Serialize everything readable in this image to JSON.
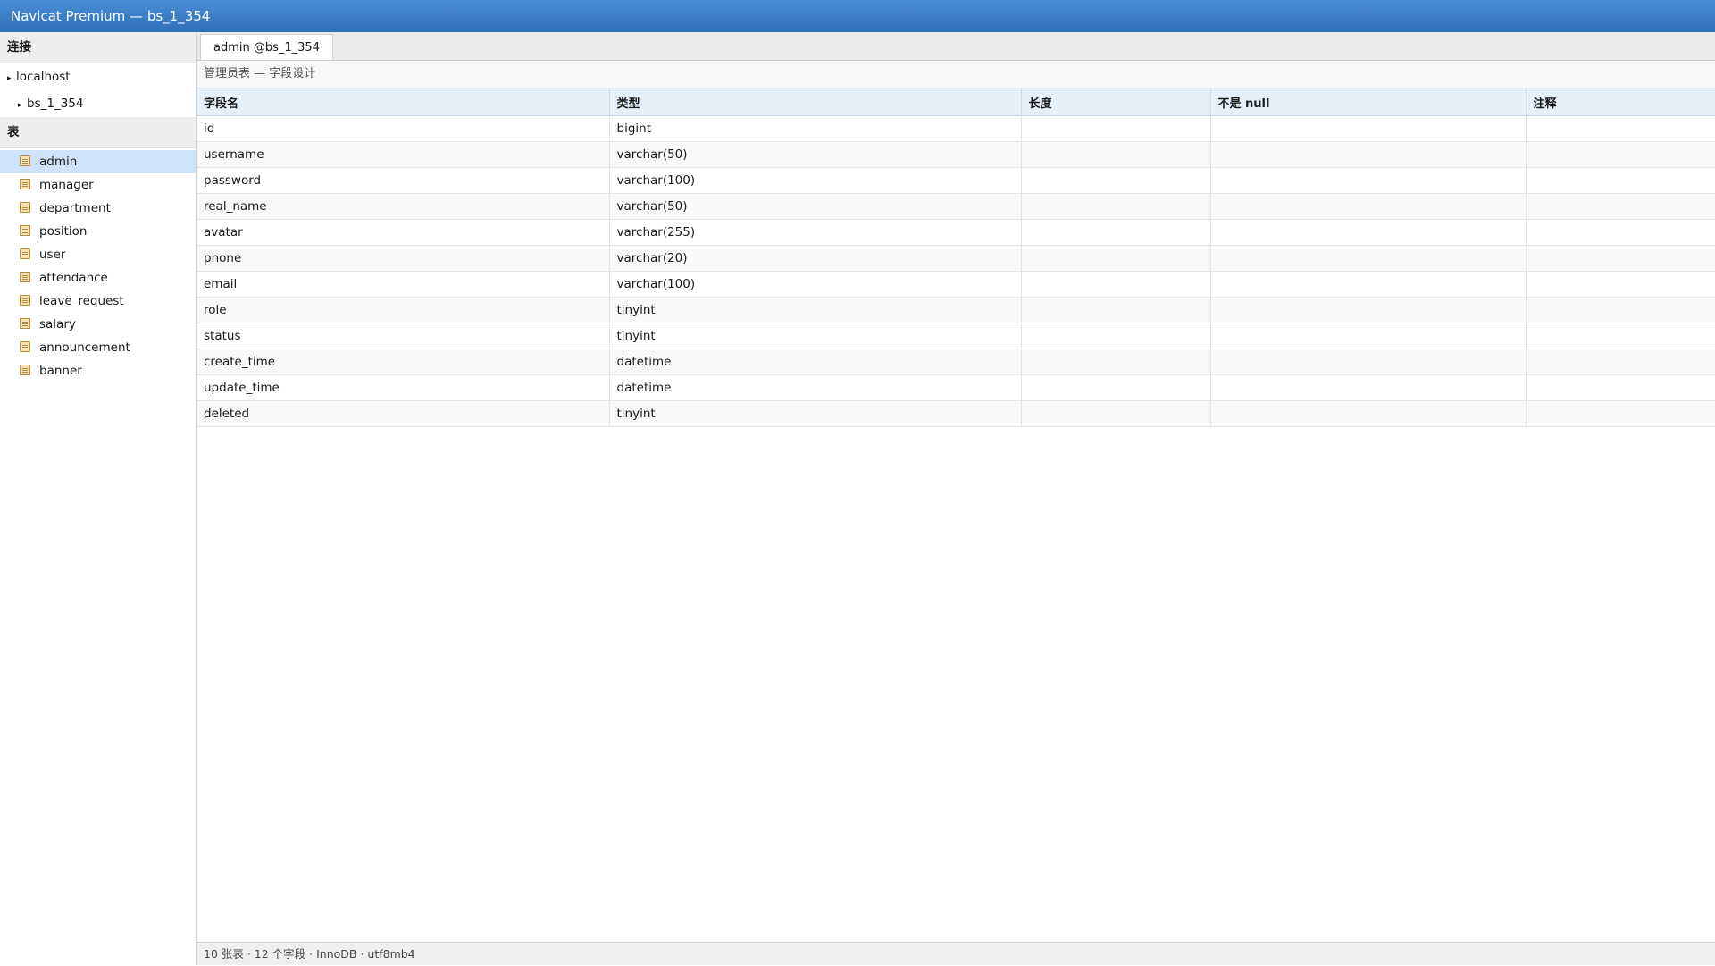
{
  "window": {
    "title": "Navicat Premium — bs_1_354"
  },
  "sidebar": {
    "connections_header": "连接",
    "connection": "localhost",
    "database": "bs_1_354",
    "tables_header": "表",
    "tables": [
      "admin",
      "manager",
      "department",
      "position",
      "user",
      "attendance",
      "leave_request",
      "salary",
      "announcement",
      "banner"
    ],
    "active_table": "admin"
  },
  "tab": {
    "label": "admin @bs_1_354"
  },
  "designer": {
    "subtitle": "管理员表 — 字段设计",
    "columns": [
      "字段名",
      "类型",
      "长度",
      "不是 null",
      "注释"
    ],
    "rows": [
      [
        "id",
        "bigint",
        "",
        "",
        ""
      ],
      [
        "username",
        "varchar(50)",
        "",
        "",
        ""
      ],
      [
        "password",
        "varchar(100)",
        "",
        "",
        ""
      ],
      [
        "real_name",
        "varchar(50)",
        "",
        "",
        ""
      ],
      [
        "avatar",
        "varchar(255)",
        "",
        "",
        ""
      ],
      [
        "phone",
        "varchar(20)",
        "",
        "",
        ""
      ],
      [
        "email",
        "varchar(100)",
        "",
        "",
        ""
      ],
      [
        "role",
        "tinyint",
        "",
        "",
        ""
      ],
      [
        "status",
        "tinyint",
        "",
        "",
        ""
      ],
      [
        "create_time",
        "datetime",
        "",
        "",
        ""
      ],
      [
        "update_time",
        "datetime",
        "",
        "",
        ""
      ],
      [
        "deleted",
        "tinyint",
        "",
        "",
        ""
      ]
    ]
  },
  "status": {
    "text": "10 张表 · 12 个字段 · InnoDB · utf8mb4"
  }
}
